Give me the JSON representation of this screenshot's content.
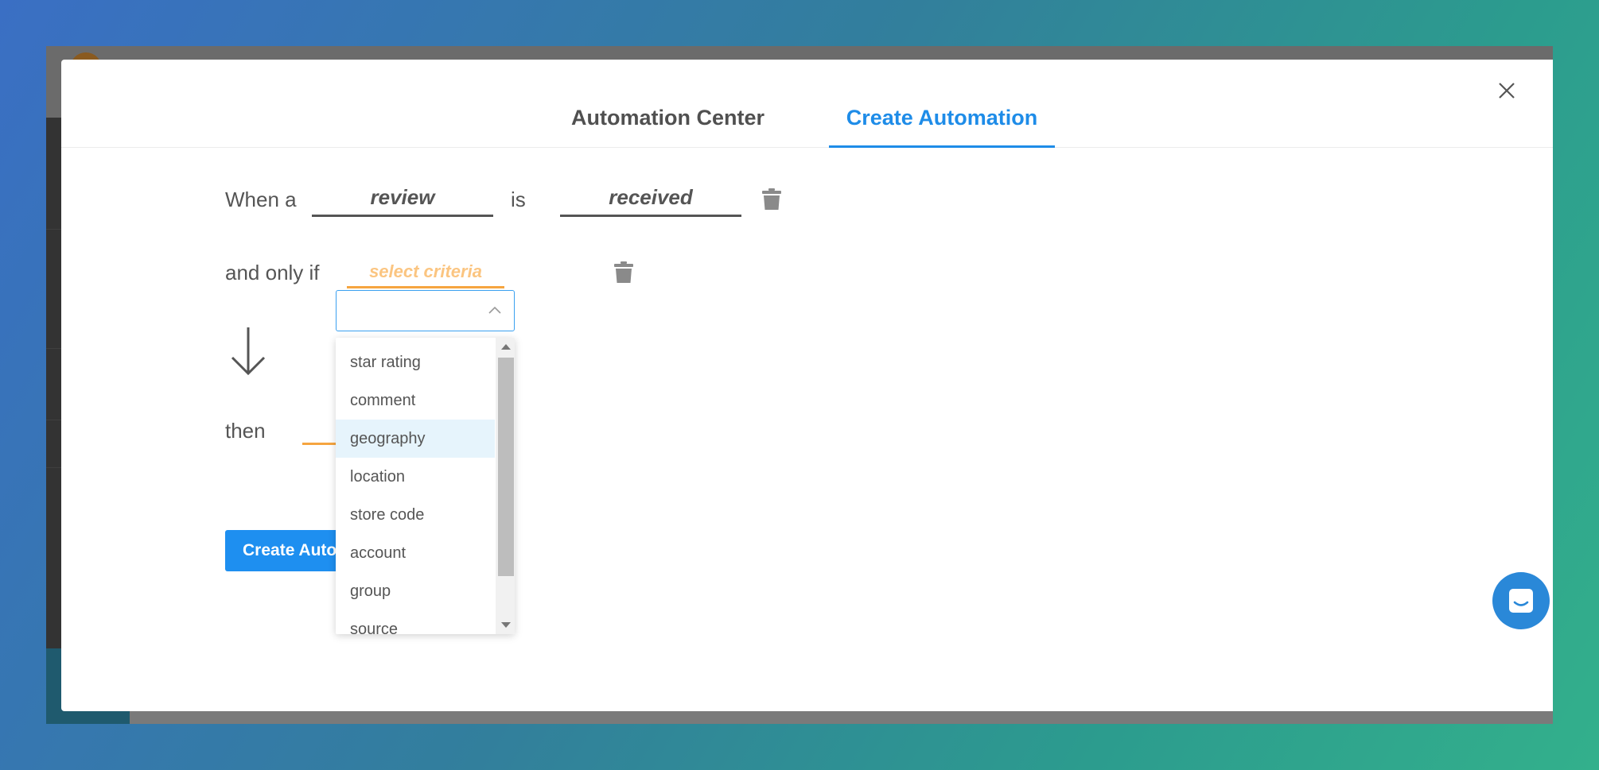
{
  "tabs": {
    "automation_center": "Automation Center",
    "create_automation": "Create Automation"
  },
  "rule": {
    "when_label": "When a",
    "when_value": "review",
    "is_label": "is",
    "is_value": "received",
    "and_only_if_label": "and only if",
    "criteria_placeholder": "select criteria",
    "then_label": "then"
  },
  "dropdown": {
    "options": [
      "star rating",
      "comment",
      "geography",
      "location",
      "store code",
      "account",
      "group",
      "source"
    ],
    "highlighted": "geography"
  },
  "buttons": {
    "create_automation": "Create Automation"
  },
  "colors": {
    "accent": "#1e8ce8",
    "criteria_underline": "#f6a540",
    "criteria_text": "#fbc581"
  },
  "icons": {
    "close": "close-icon",
    "trash": "trash-icon",
    "arrow": "arrow-down-icon",
    "chevron": "chevron-up-icon",
    "chat": "chat-icon"
  }
}
